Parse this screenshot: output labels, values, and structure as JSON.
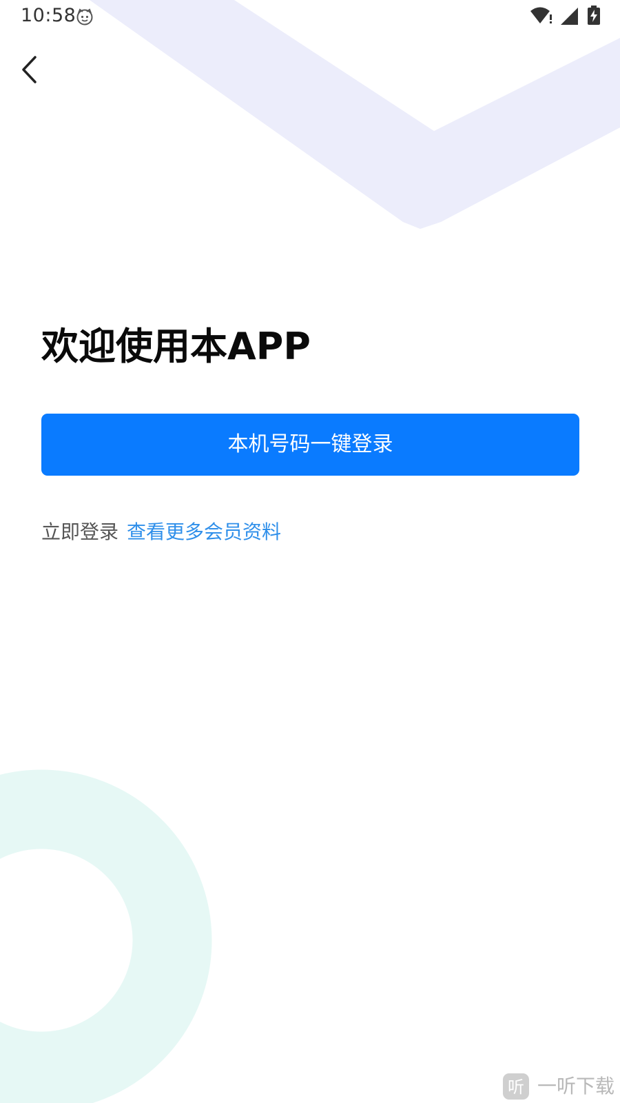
{
  "status_bar": {
    "time": "10:58",
    "icons": [
      "cat-face-icon",
      "wifi-icon",
      "signal-icon",
      "battery-charging-icon"
    ]
  },
  "nav": {
    "back_icon": "chevron-left-icon"
  },
  "main": {
    "welcome_title": "欢迎使用本APP",
    "one_click_login_label": "本机号码一键登录",
    "login_now_text": "立即登录",
    "more_member_info_link": "查看更多会员资料"
  },
  "watermark": {
    "logo_char": "听",
    "text": "一听下载"
  },
  "colors": {
    "primary_button": "#0a7bff",
    "link": "#2f8fea",
    "decor_purple": "#ecedfb",
    "decor_mint": "#e6f8f5"
  }
}
